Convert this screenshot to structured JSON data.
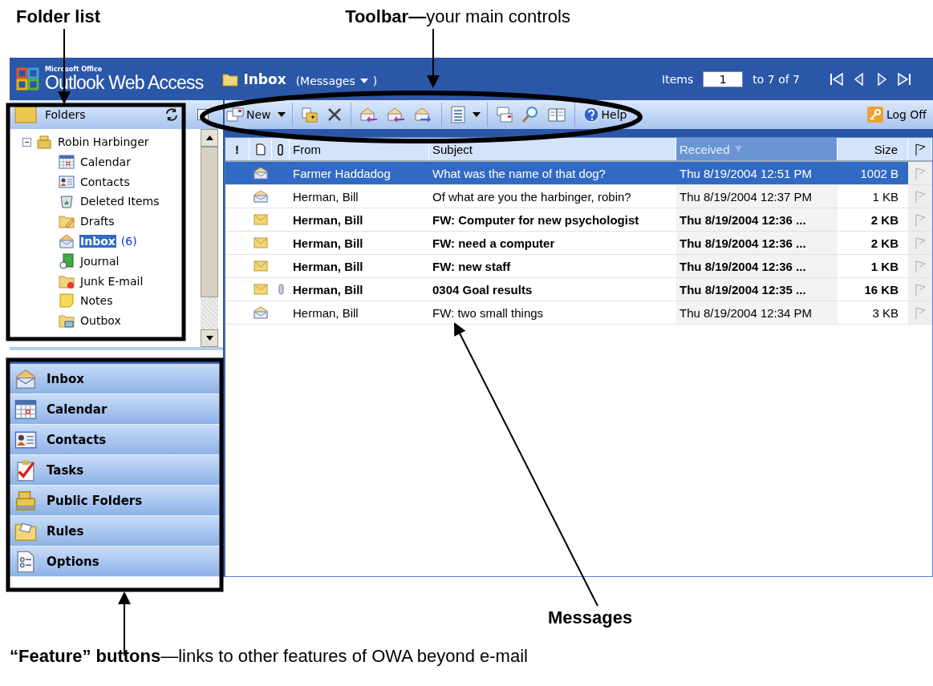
{
  "annotations": {
    "folder_list": "Folder list",
    "toolbar": "**Toolbar—**your main controls",
    "messages": "Messages",
    "features": "**“Feature” buttons**—links to other features of OWA beyond e-mail"
  },
  "header": {
    "brand_small": "Microsoft Office",
    "brand": "Outlook Web Access",
    "folder": "Inbox",
    "view_open": "(",
    "view": "Messages",
    "view_close": ")",
    "items_label": "Items",
    "item_value": "1",
    "items_range": "to 7 of 7"
  },
  "folders_pane": {
    "title": "Folders"
  },
  "folder_tree": {
    "name": "Robin Harbinger",
    "expanded": true,
    "children": [
      {
        "name": "Calendar",
        "kind": "calendar",
        "selected": false
      },
      {
        "name": "Contacts",
        "kind": "contacts",
        "selected": false
      },
      {
        "name": "Deleted Items",
        "kind": "deleted",
        "selected": false
      },
      {
        "name": "Drafts",
        "kind": "drafts",
        "selected": false
      },
      {
        "name": "Inbox",
        "kind": "inbox",
        "selected": true,
        "count": "(6)"
      },
      {
        "name": "Journal",
        "kind": "journal",
        "selected": false
      },
      {
        "name": "Junk E-mail",
        "kind": "junk",
        "selected": false
      },
      {
        "name": "Notes",
        "kind": "notes",
        "selected": false
      },
      {
        "name": "Outbox",
        "kind": "outbox",
        "selected": false
      }
    ]
  },
  "toolbar": {
    "new": "New",
    "help": "Help",
    "log_off": "Log Off"
  },
  "feature_buttons": [
    {
      "label": "Inbox",
      "kind": "inbox"
    },
    {
      "label": "Calendar",
      "kind": "calendar"
    },
    {
      "label": "Contacts",
      "kind": "contacts"
    },
    {
      "label": "Tasks",
      "kind": "tasks"
    },
    {
      "label": "Public Folders",
      "kind": "public"
    },
    {
      "label": "Rules",
      "kind": "rules"
    },
    {
      "label": "Options",
      "kind": "options"
    }
  ],
  "message_list": {
    "columns": [
      {
        "kind": "importance",
        "label": "!",
        "sorted": false
      },
      {
        "kind": "type",
        "sorted": false
      },
      {
        "kind": "attachment",
        "sorted": false
      },
      {
        "kind": "from",
        "label": "From",
        "sorted": false
      },
      {
        "kind": "subject",
        "label": "Subject",
        "sorted": false
      },
      {
        "kind": "received",
        "label": "Received",
        "sorted": true
      },
      {
        "kind": "size",
        "label": "Size",
        "sorted": false
      },
      {
        "kind": "flag",
        "sorted": false
      }
    ],
    "rows": [
      {
        "from": "Farmer Haddadog",
        "subject": "What was the name of that dog?",
        "received": "Thu 8/19/2004 12:51 PM",
        "size": "1002 B",
        "selected": true,
        "read": true,
        "attachment": false
      },
      {
        "from": "Herman, Bill",
        "subject": "Of what are you the harbinger, robin?",
        "received": "Thu 8/19/2004 12:37 PM",
        "size": "1 KB",
        "selected": false,
        "read": true,
        "attachment": false
      },
      {
        "from": "Herman, Bill",
        "subject": "FW: Computer for new psychologist",
        "received": "Thu 8/19/2004 12:36 ...",
        "size": "2 KB",
        "selected": false,
        "read": false,
        "attachment": false
      },
      {
        "from": "Herman, Bill",
        "subject": "FW: need a computer",
        "received": "Thu 8/19/2004 12:36 ...",
        "size": "2 KB",
        "selected": false,
        "read": false,
        "attachment": false
      },
      {
        "from": "Herman, Bill",
        "subject": "FW: new staff",
        "received": "Thu 8/19/2004 12:36 ...",
        "size": "1 KB",
        "selected": false,
        "read": false,
        "attachment": false
      },
      {
        "from": "Herman, Bill",
        "subject": "0304 Goal results",
        "received": "Thu 8/19/2004 12:35 ...",
        "size": "16 KB",
        "selected": false,
        "read": false,
        "attachment": true
      },
      {
        "from": "Herman, Bill",
        "subject": "FW: two small things",
        "received": "Thu 8/19/2004 12:34 PM",
        "size": "3 KB",
        "selected": false,
        "read": true,
        "attachment": false
      }
    ]
  }
}
